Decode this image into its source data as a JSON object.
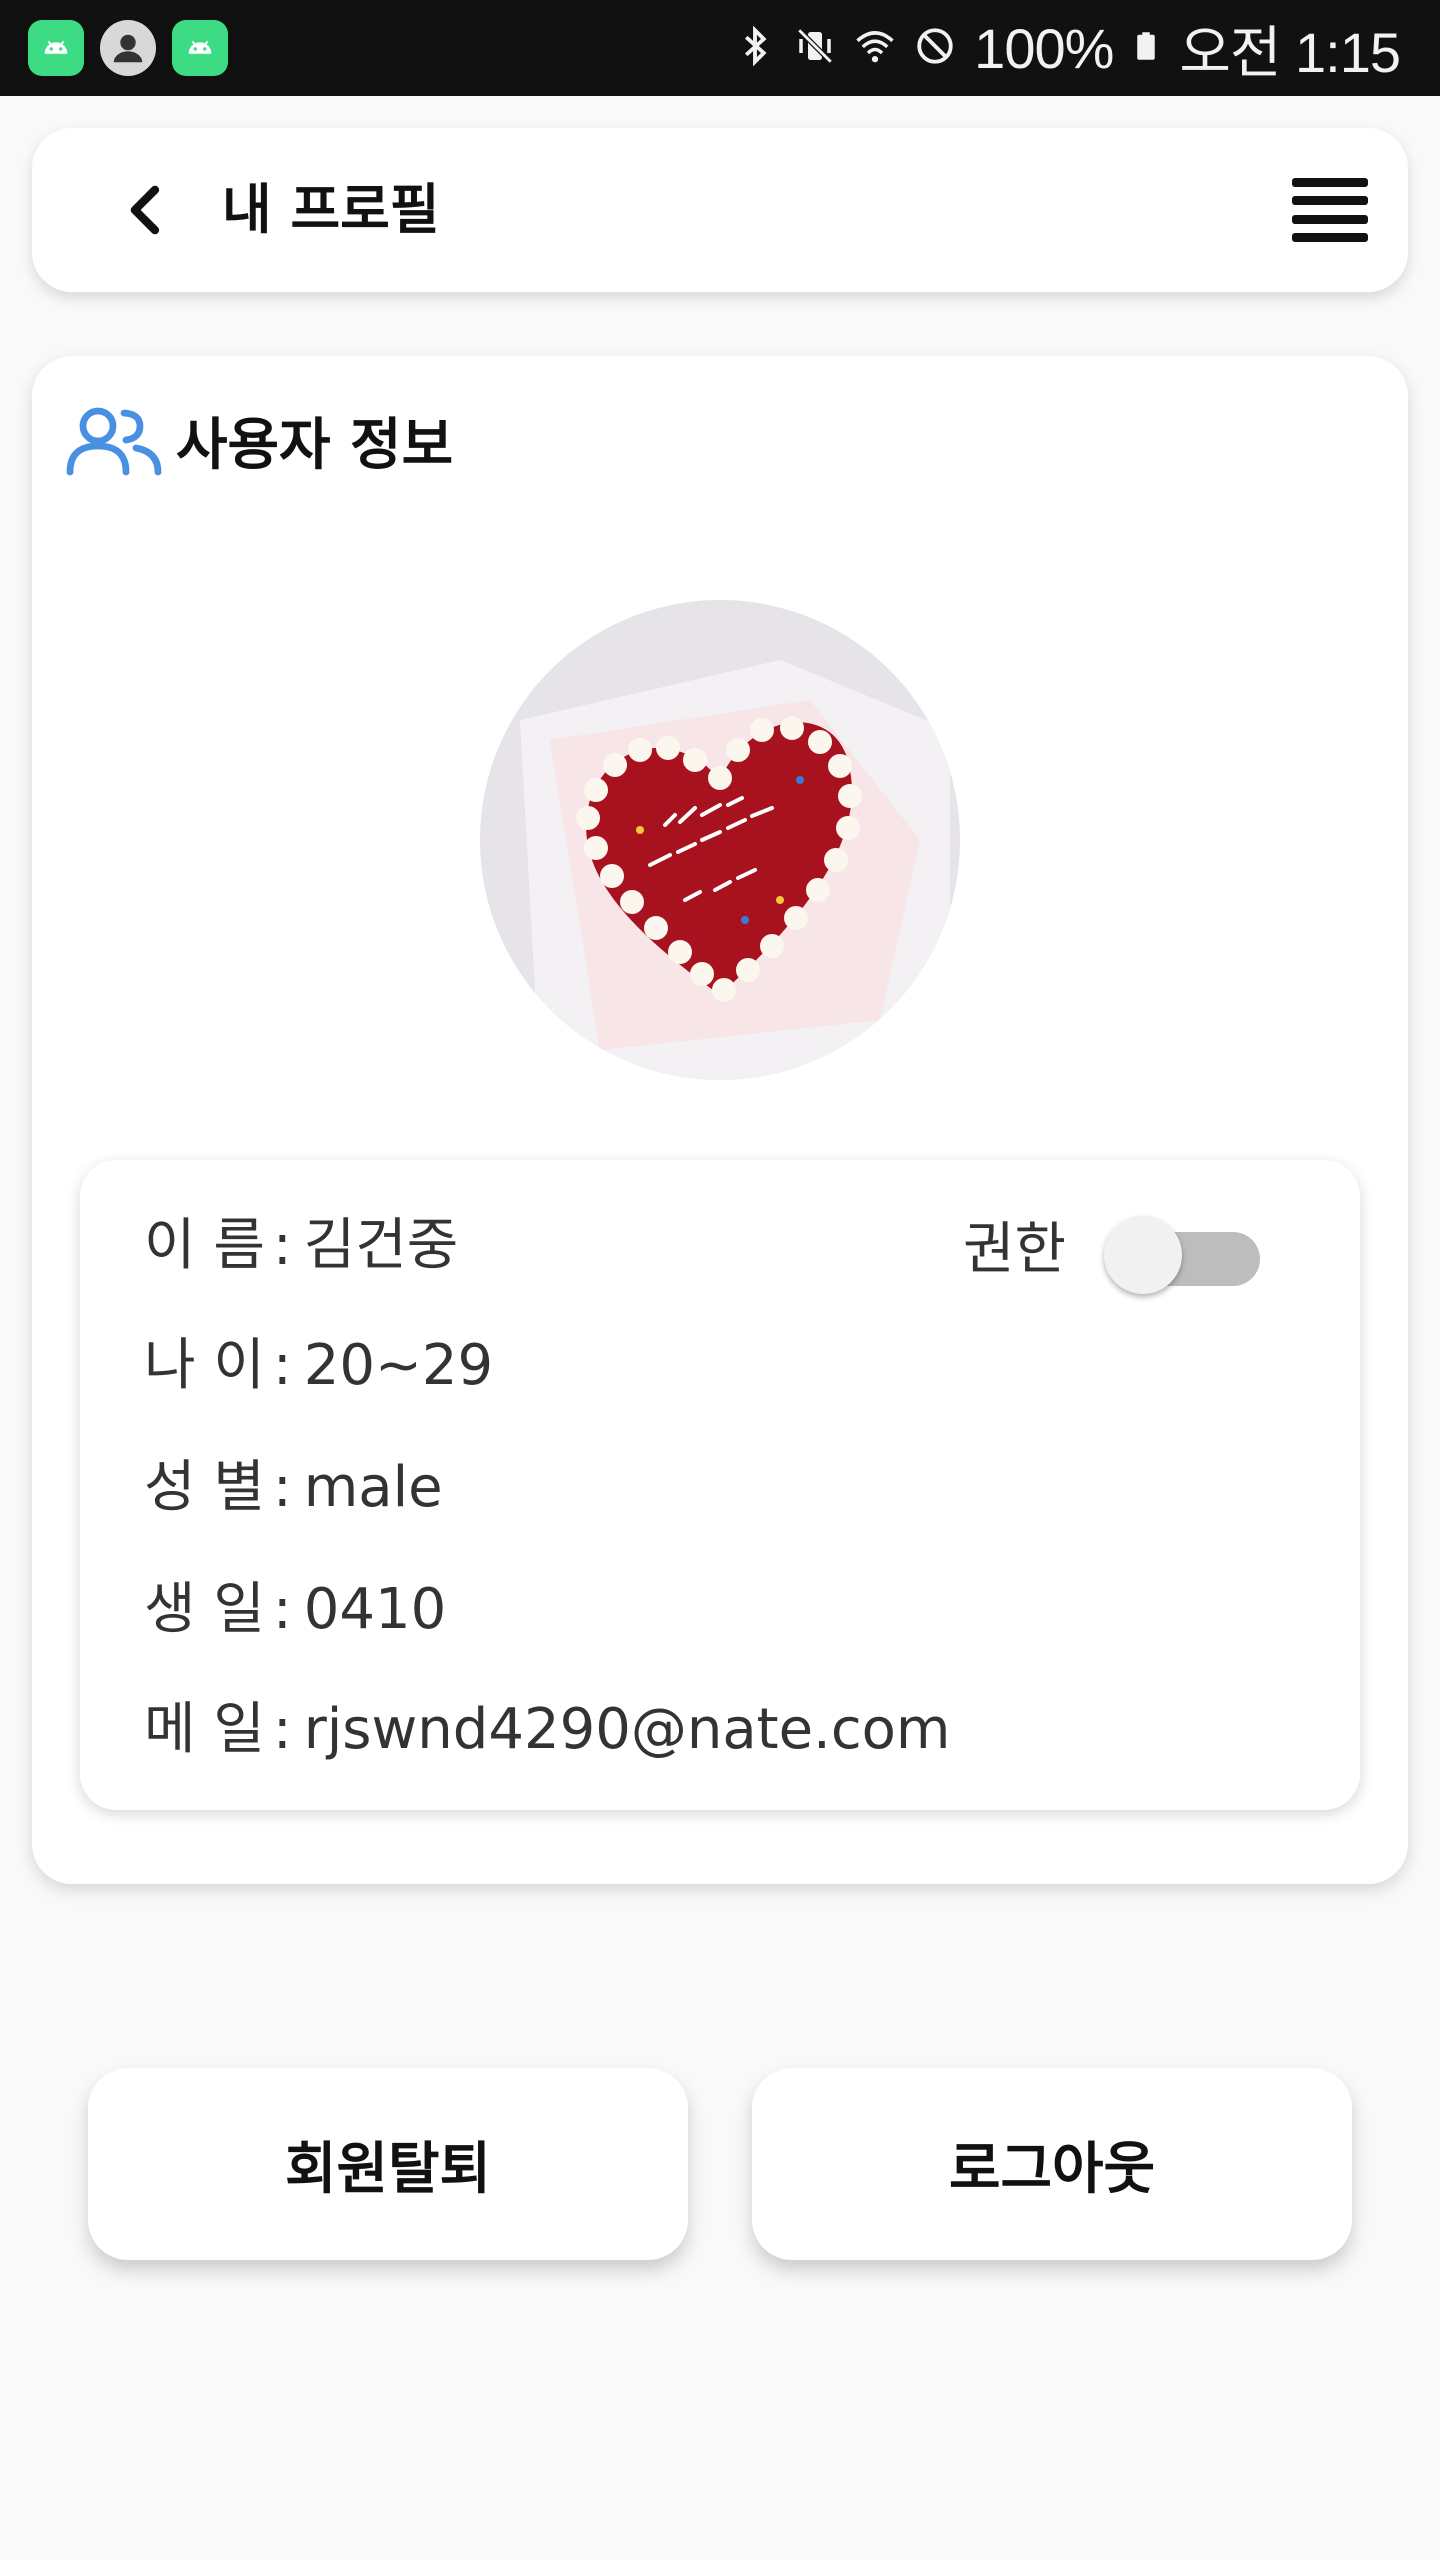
{
  "status_bar": {
    "battery": "100%",
    "time": "오전 1:15",
    "icons": [
      "android-app-icon",
      "account-circle-icon",
      "android-app-icon",
      "bluetooth-icon",
      "vibrate-mute-icon",
      "wifi-icon",
      "do-not-disturb-icon",
      "battery-icon"
    ]
  },
  "header": {
    "title": "내 프로필",
    "back_icon": "chevron-left-icon",
    "menu_icon": "hamburger-menu-icon"
  },
  "user_info": {
    "section_title": "사용자 정보",
    "section_icon": "users-icon",
    "avatar_icon": "profile-photo",
    "fields": [
      {
        "label": "이 름",
        "value": "김건중"
      },
      {
        "label": "나 이",
        "value": "20~29"
      },
      {
        "label": "성 별",
        "value": "male"
      },
      {
        "label": "생 일",
        "value": "0410"
      },
      {
        "label": "메 일",
        "value": "rjswnd4290@nate.com"
      }
    ],
    "permission_label": "권한",
    "permission_enabled": false
  },
  "actions": {
    "withdraw_label": "회원탈퇴",
    "logout_label": "로그아웃"
  },
  "colors": {
    "accent_icon": "#4a90e2",
    "status_bar_bg": "#111111",
    "page_bg": "#f9f9f9",
    "android_green": "#3ddc84"
  }
}
